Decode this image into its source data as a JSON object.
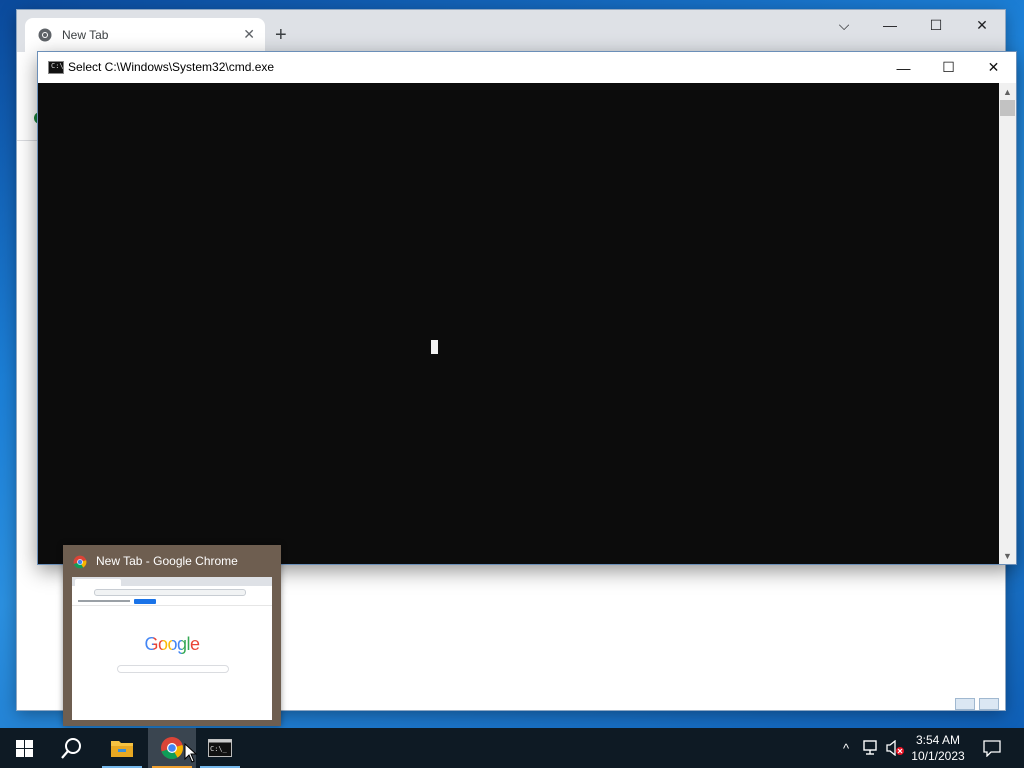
{
  "chrome": {
    "tab_title": "New Tab",
    "tab_close": "✕",
    "new_tab": "+",
    "ctrl_list": "⌵",
    "ctrl_minimize": "—",
    "ctrl_maximize": "☐",
    "ctrl_close": "✕"
  },
  "cmd": {
    "title": "Select C:\\Windows\\System32\\cmd.exe",
    "icon_text": "C:\\",
    "ctrl_minimize": "—",
    "ctrl_maximize": "☐",
    "ctrl_close": "✕",
    "scroll_up": "▲",
    "scroll_down": "▼"
  },
  "preview": {
    "title": "New Tab - Google Chrome",
    "logo_text": "Google"
  },
  "taskbar": {
    "time": "3:54 AM",
    "date": "10/1/2023",
    "tray_chevron": "^"
  },
  "colors": {
    "desktop": "#1c7fd6",
    "taskbar": "#0e1a24",
    "console_bg": "#0c0c0c",
    "accent_underline": "#76b9ed"
  }
}
